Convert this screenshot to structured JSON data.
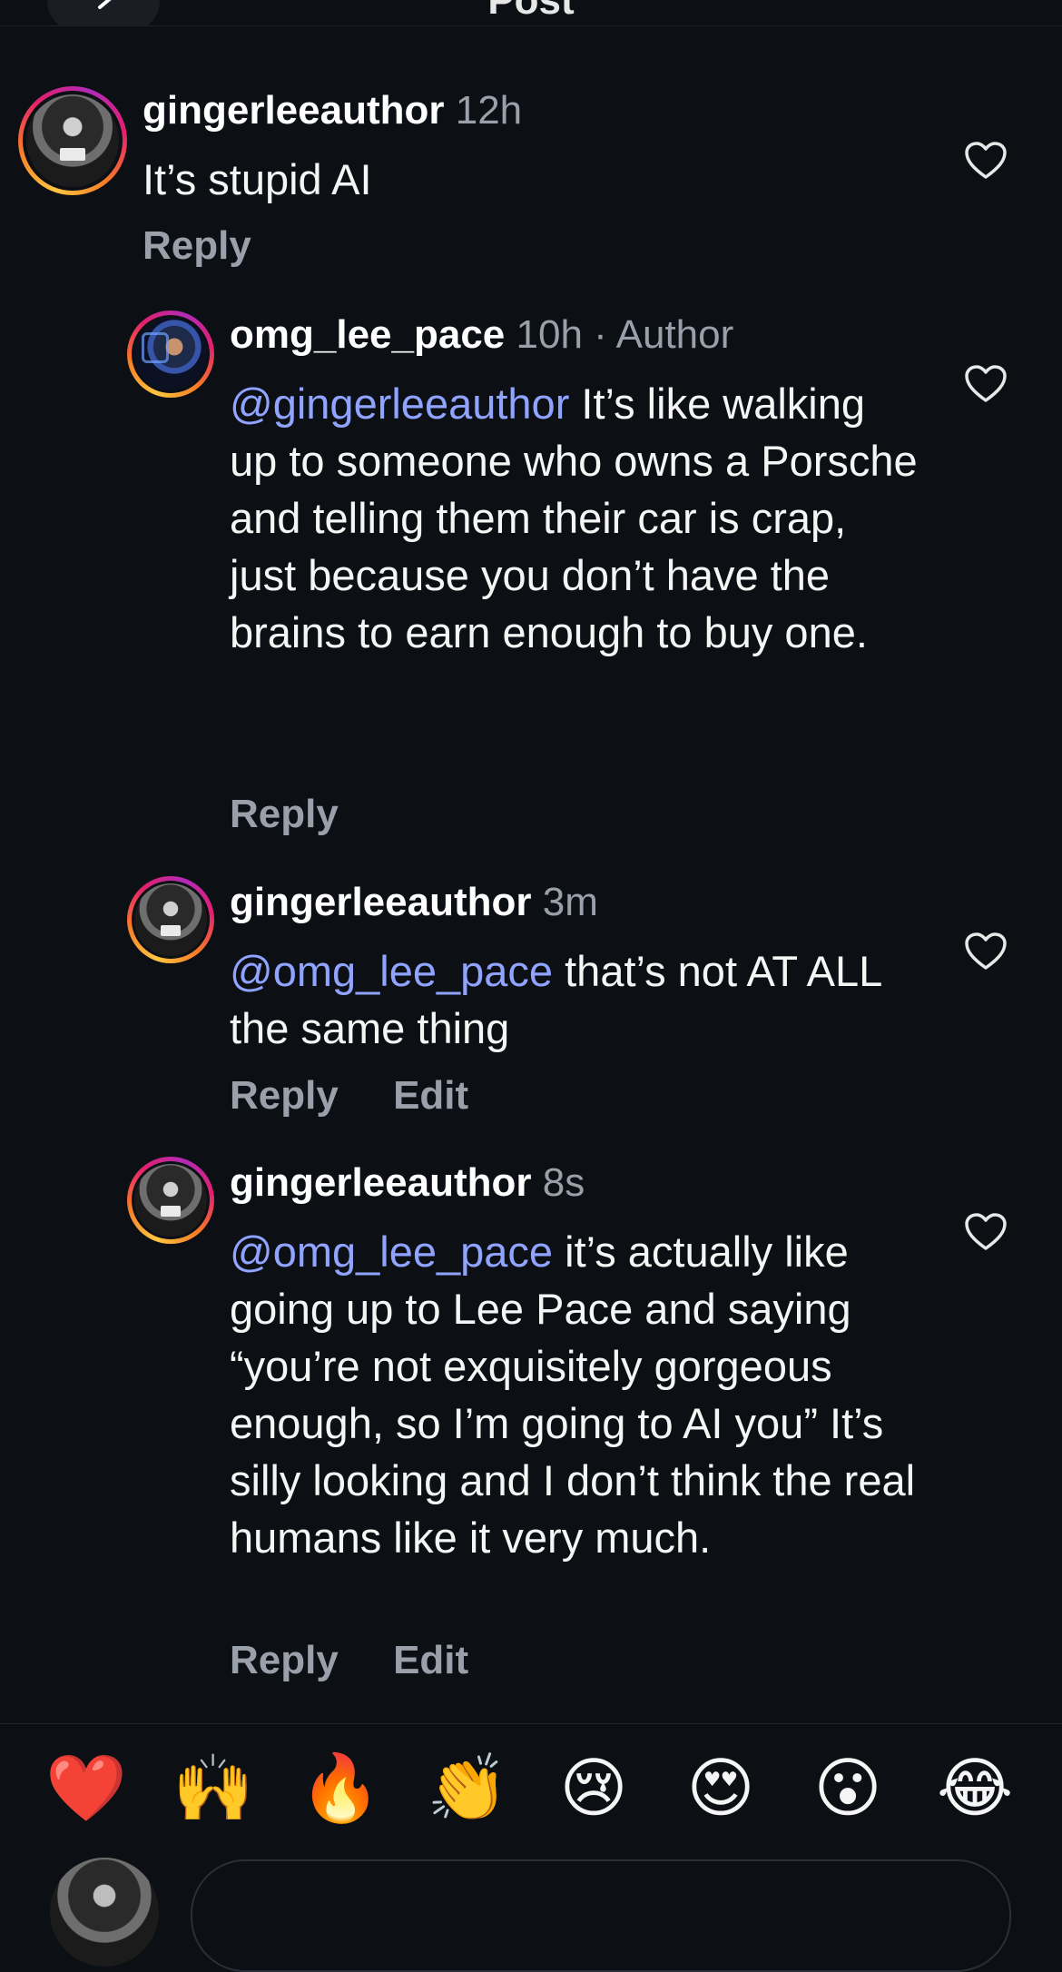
{
  "header": {
    "title": "Post"
  },
  "colors": {
    "background": "#0c0f14",
    "mention": "#8fa3ff",
    "muted": "#9aa0aa"
  },
  "comments": [
    {
      "username": "gingerleeauthor",
      "time": "12h",
      "author_tag": "",
      "mention": "",
      "text": "It’s stupid AI",
      "actions": [
        "Reply"
      ]
    },
    {
      "username": "omg_lee_pace",
      "time": "10h",
      "author_tag": "· Author",
      "mention": "@gingerleeauthor",
      "text": " It’s like walking up to someone who owns a Porsche and telling them their car is crap, just because you don’t have the brains to earn enough to buy one.",
      "actions": [
        "Reply"
      ]
    },
    {
      "username": "gingerleeauthor",
      "time": "3m",
      "author_tag": "",
      "mention": "@omg_lee_pace",
      "text": " that’s not AT ALL the same thing",
      "actions": [
        "Reply",
        "Edit"
      ]
    },
    {
      "username": "gingerleeauthor",
      "time": "8s",
      "author_tag": "",
      "mention": "@omg_lee_pace",
      "text": " it’s actually like going up to Lee Pace and saying “you’re not exquisitely gorgeous enough, so I’m going to AI you” It’s silly looking and I don’t think the real humans like it very much.",
      "actions": [
        "Reply",
        "Edit"
      ]
    }
  ],
  "reactions": [
    "❤️",
    "🙌",
    "🔥",
    "👏",
    "😢",
    "😍",
    "😮",
    "😂"
  ],
  "icons": {
    "like": "heart-outline-icon",
    "back": "chevron-left-icon"
  }
}
